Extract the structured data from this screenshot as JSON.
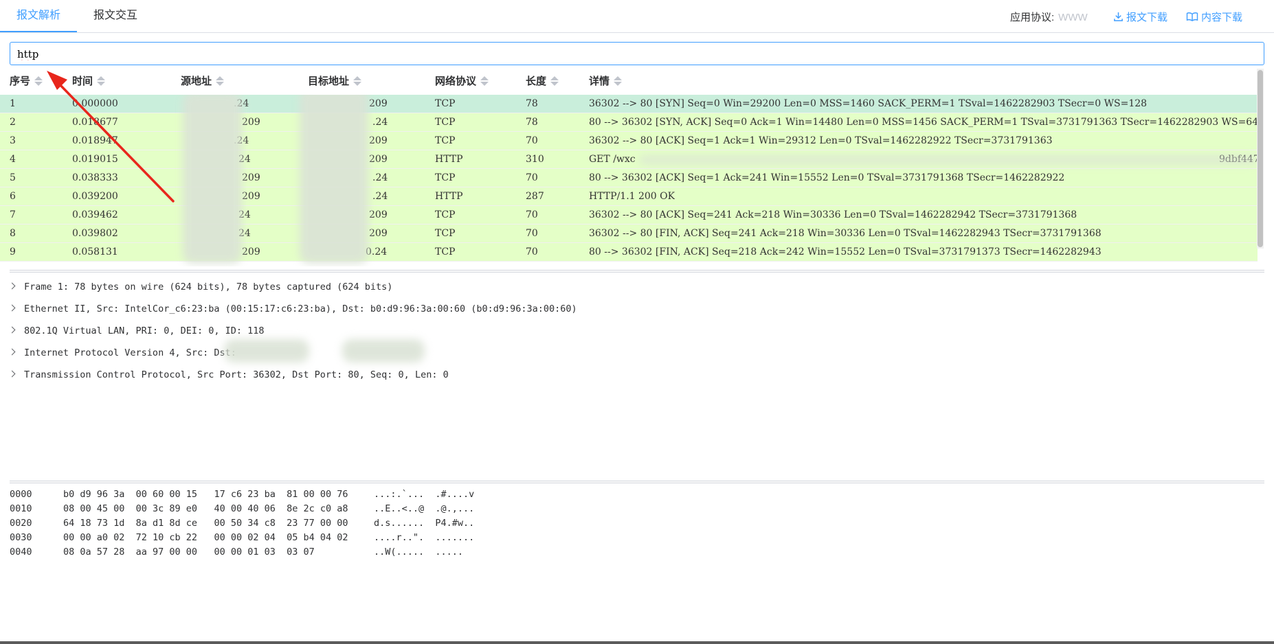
{
  "tabs": [
    {
      "label": "报文解析",
      "active": true
    },
    {
      "label": "报文交互",
      "active": false
    }
  ],
  "header": {
    "protocol_label": "应用协议:",
    "protocol_value": "WWW",
    "download_packet": "报文下载",
    "download_content": "内容下载"
  },
  "filter": {
    "value": "http"
  },
  "table": {
    "columns": [
      "序号",
      "时间",
      "源地址",
      "目标地址",
      "网络协议",
      "长度",
      "详情"
    ],
    "rows": [
      {
        "no": "1",
        "time": "0.000000",
        "src": ".24",
        "dst": "209",
        "proto": "TCP",
        "len": "78",
        "info": "36302 --> 80 [SYN] Seq=0 Win=29200 Len=0 MSS=1460 SACK_PERM=1 TSval=1462282903 TSecr=0 WS=128"
      },
      {
        "no": "2",
        "time": "0.018677",
        "src": "209",
        "dst": ".24",
        "proto": "TCP",
        "len": "78",
        "info": "80 --> 36302 [SYN, ACK] Seq=0 Ack=1 Win=14480 Len=0 MSS=1456 SACK_PERM=1 TSval=3731791363 TSecr=1462282903 WS=64"
      },
      {
        "no": "3",
        "time": "0.018947",
        "src": ".24",
        "dst": "209",
        "proto": "TCP",
        "len": "70",
        "info": "36302 --> 80 [ACK] Seq=1 Ack=1 Win=29312 Len=0 TSval=1462282922 TSecr=3731791363"
      },
      {
        "no": "4",
        "time": "0.019015",
        "src": "24",
        "dst": "209",
        "proto": "HTTP",
        "len": "310",
        "info": "GET /wxc"
      },
      {
        "no": "5",
        "time": "0.038333",
        "src": "209",
        "dst": ".24",
        "proto": "TCP",
        "len": "70",
        "info": "80 --> 36302 [ACK] Seq=1 Ack=241 Win=15552 Len=0 TSval=3731791368 TSecr=1462282922"
      },
      {
        "no": "6",
        "time": "0.039200",
        "src": "209",
        "dst": ".24",
        "proto": "HTTP",
        "len": "287",
        "info": "HTTP/1.1 200 OK"
      },
      {
        "no": "7",
        "time": "0.039462",
        "src": "24",
        "dst": "209",
        "proto": "TCP",
        "len": "70",
        "info": "36302 --> 80 [ACK] Seq=241 Ack=218 Win=30336 Len=0 TSval=1462282942 TSecr=3731791368"
      },
      {
        "no": "8",
        "time": "0.039802",
        "src": "24",
        "dst": "209",
        "proto": "TCP",
        "len": "70",
        "info": "36302 --> 80 [FIN, ACK] Seq=241 Ack=218 Win=30336 Len=0 TSval=1462282943 TSecr=3731791368"
      },
      {
        "no": "9",
        "time": "0.058131",
        "src": "209",
        "dst": "0.24",
        "proto": "TCP",
        "len": "70",
        "info": "80 --> 36302 [FIN, ACK] Seq=218 Ack=242 Win=15552 Len=0 TSval=3731791373 TSecr=1462282943"
      }
    ],
    "row4_tail": "9dbf447"
  },
  "tree": [
    "Frame 1: 78 bytes on wire (624 bits), 78 bytes captured (624 bits)",
    "Ethernet II, Src: IntelCor_c6:23:ba (00:15:17:c6:23:ba), Dst: b0:d9:96:3a:00:60 (b0:d9:96:3a:00:60)",
    "802.1Q Virtual LAN, PRI: 0, DEI: 0, ID: 118",
    "Internet Protocol Version 4, Src:                 Dst:",
    "Transmission Control Protocol, Src Port: 36302, Dst Port: 80, Seq: 0, Len: 0"
  ],
  "hex": [
    {
      "offset": "0000",
      "bytes": "b0 d9 96 3a  00 60 00 15   17 c6 23 ba  81 00 00 76",
      "ascii": "...:.`...  .#....v"
    },
    {
      "offset": "0010",
      "bytes": "08 00 45 00  00 3c 89 e0   40 00 40 06  8e 2c c0 a8",
      "ascii": "..E..<..@  .@.,..."
    },
    {
      "offset": "0020",
      "bytes": "64 18 73 1d  8a d1 8d ce   00 50 34 c8  23 77 00 00",
      "ascii": "d.s......  P4.#w.."
    },
    {
      "offset": "0030",
      "bytes": "00 00 a0 02  72 10 cb 22   00 00 02 04  05 b4 04 02",
      "ascii": "....r..\".  ......."
    },
    {
      "offset": "0040",
      "bytes": "08 0a 57 28  aa 97 00 00   00 00 01 03  03 07",
      "ascii": "..W(.....  ....."
    }
  ],
  "colors": {
    "accent": "#409eff",
    "row_bg": "#e4ffc7",
    "row_selected": "#c9eedb",
    "annotation_arrow": "#e8261c"
  }
}
